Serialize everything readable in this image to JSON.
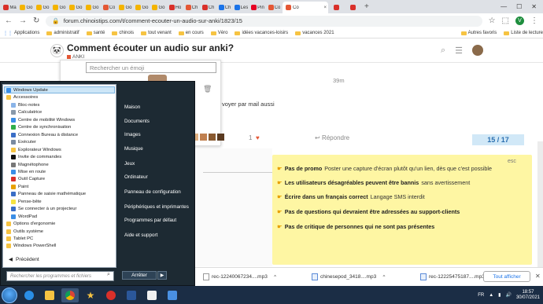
{
  "browser": {
    "tabs": [
      {
        "label": "Ma",
        "color": "#d9302a"
      },
      {
        "label": "Go",
        "color": "#f4b400"
      },
      {
        "label": "Go",
        "color": "#f4b400"
      },
      {
        "label": "Go",
        "color": "#f4b400"
      },
      {
        "label": "Go",
        "color": "#f4b400"
      },
      {
        "label": "Go",
        "color": "#f4b400"
      },
      {
        "label": "Co",
        "color": "#e45735"
      },
      {
        "label": "Go",
        "color": "#f4b400"
      },
      {
        "label": "Go",
        "color": "#f4b400"
      },
      {
        "label": "Go",
        "color": "#f4b400"
      },
      {
        "label": "Ho",
        "color": "#d9302a"
      },
      {
        "label": "Ch",
        "color": "#e45735"
      },
      {
        "label": "Ch",
        "color": "#d9302a"
      },
      {
        "label": "Ch",
        "color": "#1a73e8"
      },
      {
        "label": "Les",
        "color": "#1a73e8"
      },
      {
        "label": "Pin",
        "color": "#e60023"
      },
      {
        "label": "Co",
        "color": "#e45735"
      }
    ],
    "active_tab": {
      "label": "Co",
      "close": "×"
    },
    "extra_tabs": [
      {
        "label": "Co",
        "color": "#d9302a"
      },
      {
        "label": "Co",
        "color": "#d9302a"
      }
    ],
    "new_tab": "+",
    "window_controls": {
      "minimize": "—",
      "maximize": "☐",
      "close": "✕"
    },
    "url": "forum.chinoistips.com/t/comment-ecouter-un-audio-sur-anki/1823/15",
    "profile_initial": "V",
    "bookmarks": [
      {
        "label": "Applications",
        "icon": "apps-icon"
      },
      {
        "label": "administratif"
      },
      {
        "label": "santé"
      },
      {
        "label": "chinois"
      },
      {
        "label": "tout venant"
      },
      {
        "label": "en cours"
      },
      {
        "label": "Véro"
      },
      {
        "label": "idées vacances-loisirs"
      },
      {
        "label": "vacances 2021"
      }
    ],
    "bookmarks_right": [
      {
        "label": "Autres favoris"
      },
      {
        "label": "Liste de lecture"
      }
    ]
  },
  "forum": {
    "title": "Comment écouter un audio sur anki?",
    "category": "ANKI",
    "emoji_search_placeholder": "Rechercher un émoji",
    "post_time": "39m",
    "post_text": "voyer par mail aussi",
    "likes": "1",
    "reply_label": "Répondre",
    "progress": "15 / 17",
    "notice": {
      "esc": "esc",
      "rules": [
        {
          "bold": "Pas de promo",
          "text": "Poster une capture d'écran plutôt qu'un lien, dès que c'est possible"
        },
        {
          "bold": "Les utilisateurs désagréables peuvent être bannis",
          "text": "sans avertissement"
        },
        {
          "bold": "Écrire dans un français correct",
          "text": "Langage SMS interdit"
        },
        {
          "bold": "Pas de questions qui devraient être adressées au support-clients",
          "text": ""
        },
        {
          "bold": "Pas de critique de personnes qui ne sont pas présentes",
          "text": ""
        }
      ]
    }
  },
  "downloads": {
    "items": [
      {
        "name": "rec-12240067234....mp3"
      },
      {
        "name": "chinesepod_3418....mp3"
      },
      {
        "name": "rec-12225475187....mp3"
      }
    ],
    "show_all": "Tout afficher",
    "close": "✕"
  },
  "startmenu": {
    "programs": [
      {
        "label": "Windows Update",
        "color": "#3a8ee6"
      },
      {
        "label": "Accessoires",
        "color": "#f6c342"
      },
      {
        "label": "Bloc-notes",
        "color": "#8ab4e8"
      },
      {
        "label": "Calculatrice",
        "color": "#8899aa"
      },
      {
        "label": "Centre de mobilité Windows",
        "color": "#3a8ee6"
      },
      {
        "label": "Centre de synchronisation",
        "color": "#2eae4a"
      },
      {
        "label": "Connexion Bureau à distance",
        "color": "#3a6ec6"
      },
      {
        "label": "Exécuter",
        "color": "#7a8aa0"
      },
      {
        "label": "Explorateur Windows",
        "color": "#f6c342"
      },
      {
        "label": "Invite de commandes",
        "color": "#111111"
      },
      {
        "label": "Magnétophone",
        "color": "#777777"
      },
      {
        "label": "Mise en route",
        "color": "#3a8ee6"
      },
      {
        "label": "Outil Capture",
        "color": "#d9302a"
      },
      {
        "label": "Paint",
        "color": "#e8a000"
      },
      {
        "label": "Panneau de saisie mathématique",
        "color": "#3a6ec6"
      },
      {
        "label": "Pense-bête",
        "color": "#f6e342"
      },
      {
        "label": "Se connecter à un projecteur",
        "color": "#3a6ec6"
      },
      {
        "label": "WordPad",
        "color": "#3a8ee6"
      },
      {
        "label": "Options d'ergonomie",
        "color": "#f6c342"
      },
      {
        "label": "Outils système",
        "color": "#f6c342"
      },
      {
        "label": "Tablet PC",
        "color": "#f6c342"
      },
      {
        "label": "Windows PowerShell",
        "color": "#f6c342"
      }
    ],
    "back_label": "Précédent",
    "search_placeholder": "Rechercher les programmes et fichiers",
    "right": [
      "Maison",
      "Documents",
      "Images",
      "Musique",
      "Jeux",
      "Ordinateur",
      "Panneau de configuration",
      "Périphériques et imprimantes",
      "Programmes par défaut",
      "Aide et support"
    ],
    "shutdown": "Arrêter"
  },
  "taskbar": {
    "lang": "FR",
    "time": "18:57",
    "date": "30/07/2021"
  }
}
